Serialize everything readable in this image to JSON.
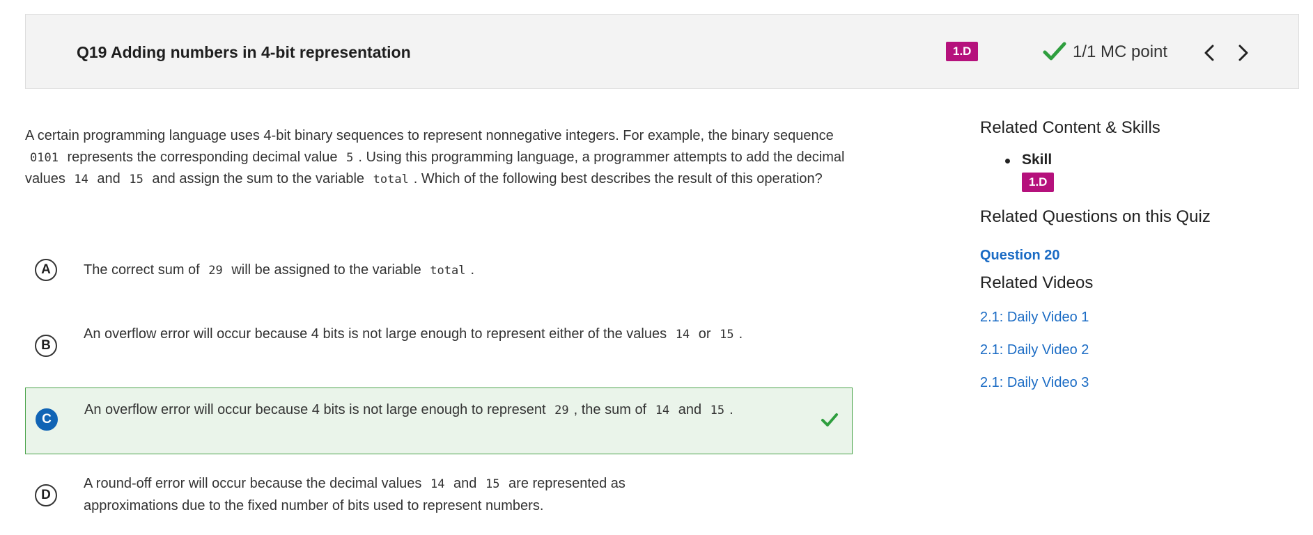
{
  "header": {
    "title": "Q19 Adding numbers in 4-bit representation",
    "skill_badge": "1.D",
    "points": "1/1 MC point",
    "check_icon": "check-icon",
    "prev_icon": "chevron-left-icon",
    "next_icon": "chevron-right-icon"
  },
  "question": {
    "p1": "A certain programming language uses 4-bit binary sequences to represent nonnegative integers. For example, the binary sequence",
    "code1": "0101",
    "p2": "represents the corresponding decimal value",
    "code2": "5",
    "p3": ". Using this programming language, a programmer attempts to add the decimal values",
    "code3": "14",
    "p4": "and",
    "code4": "15",
    "p5": "and assign the sum to the variable",
    "code5": "total",
    "p6": ". Which of the following best describes the result of this operation?"
  },
  "choices": {
    "a": {
      "letter": "A",
      "t1": "The correct sum of",
      "c1": "29",
      "t2": "will be assigned to the variable",
      "c2": "total",
      "t3": "."
    },
    "b": {
      "letter": "B",
      "t1": "An overflow error will occur because 4 bits is not large enough to represent either of the values",
      "c1": "14",
      "t2": "or",
      "c2": "15",
      "t3": "."
    },
    "c": {
      "letter": "C",
      "t1": "An overflow error will occur because 4 bits is not large enough to represent",
      "c1": "29",
      "t2": ", the sum of",
      "c2": "14",
      "t3": "and",
      "c3": "15",
      "t4": ".",
      "status": "correct"
    },
    "d": {
      "letter": "D",
      "t1": "A round-off error will occur because the decimal values",
      "c1": "14",
      "t2": "and",
      "c2": "15",
      "t3": "are represented as approximations due to the fixed number of bits used to represent numbers."
    }
  },
  "sidebar": {
    "related_heading": "Related Content & Skills",
    "skill_label": "Skill",
    "skill_badge": "1.D",
    "questions_heading": "Related Questions on this Quiz",
    "question_link": "Question 20",
    "videos_heading": "Related Videos",
    "videos": [
      "2.1: Daily Video 1",
      "2.1: Daily Video 2",
      "2.1: Daily Video 3"
    ]
  },
  "colors": {
    "badge": "#b5117c",
    "check": "#2e9e3e",
    "link": "#1a6bc4",
    "correct_bg": "#eaf4ea",
    "correct_border": "#49a349",
    "selected_letter": "#1164b5"
  }
}
